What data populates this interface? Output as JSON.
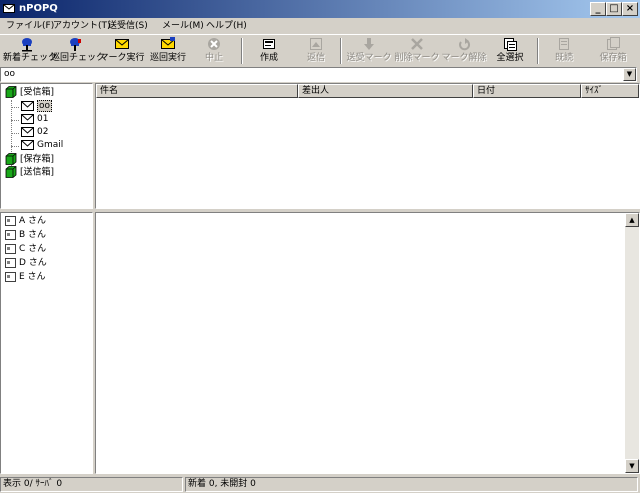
{
  "window": {
    "title": "nPOPQ"
  },
  "menu": [
    "ファイル(F)",
    "アカウント(T)",
    "送受信(S)",
    "メール(M)",
    "ヘルプ(H)"
  ],
  "toolbar": [
    {
      "label": "新着チェック",
      "icon": "mailbox-check-icon",
      "enabled": true
    },
    {
      "label": "巡回チェック",
      "icon": "mailbox-cycle-icon",
      "enabled": true
    },
    {
      "label": "マーク実行",
      "icon": "envelope-mark-icon",
      "enabled": true
    },
    {
      "label": "巡回実行",
      "icon": "envelope-cycle-icon",
      "enabled": true
    },
    {
      "label": "中止",
      "icon": "stop-icon",
      "enabled": false
    },
    {
      "label": "作成",
      "icon": "compose-icon",
      "enabled": true
    },
    {
      "label": "返信",
      "icon": "reply-icon",
      "enabled": false
    },
    {
      "label": "送受マーク",
      "icon": "down-arrow-icon",
      "enabled": false
    },
    {
      "label": "削除マーク",
      "icon": "x-icon",
      "enabled": false
    },
    {
      "label": "マーク解除",
      "icon": "undo-icon",
      "enabled": false
    },
    {
      "label": "全選択",
      "icon": "select-all-icon",
      "enabled": true
    },
    {
      "label": "既読",
      "icon": "read-icon",
      "enabled": false
    },
    {
      "label": "保存箱",
      "icon": "savebox-icon",
      "enabled": false
    }
  ],
  "account_selector": {
    "value": "oo"
  },
  "folders": [
    {
      "label": "[受信箱]",
      "level": 0,
      "type": "box"
    },
    {
      "label": "oo",
      "level": 1,
      "type": "mail",
      "selected": true
    },
    {
      "label": "01",
      "level": 1,
      "type": "mail"
    },
    {
      "label": "02",
      "level": 1,
      "type": "mail"
    },
    {
      "label": "Gmail",
      "level": 1,
      "type": "mail"
    },
    {
      "label": "[保存箱]",
      "level": 0,
      "type": "box"
    },
    {
      "label": "[送信箱]",
      "level": 0,
      "type": "box"
    }
  ],
  "columns": [
    "件名",
    "差出人",
    "日付",
    "ｻｲｽﾞ"
  ],
  "contacts": [
    "A さん",
    "B さん",
    "C さん",
    "D さん",
    "E さん"
  ],
  "status": {
    "left": "表示 0/ ｻｰﾊﾞ 0",
    "right": "新着 0, 未開封 0"
  },
  "colors": {
    "titlebar_start": "#0a246a",
    "titlebar_end": "#a6caf0",
    "box_icon": "#1aa81a",
    "face": "#d4d0c8"
  }
}
